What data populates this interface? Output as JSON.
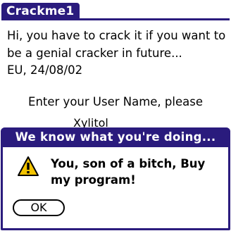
{
  "form": {
    "title": "Crackme1",
    "intro_line1": "Hi, you have to crack it if you want to",
    "intro_line2": "be a genial cracker in future...",
    "intro_line3": "EU, 24/08/02",
    "prompt": "Enter your User Name, please",
    "username_value": "Xylitol"
  },
  "alert": {
    "title": "We know what you're doing...",
    "message_line1": "You, son of a bitch, Buy",
    "message_line2": "my program!",
    "ok_label": "OK",
    "icon": "warning-icon"
  },
  "colors": {
    "title_bar": "#2a1b7d",
    "warning_fill": "#f2c300",
    "background": "#ffffff"
  }
}
